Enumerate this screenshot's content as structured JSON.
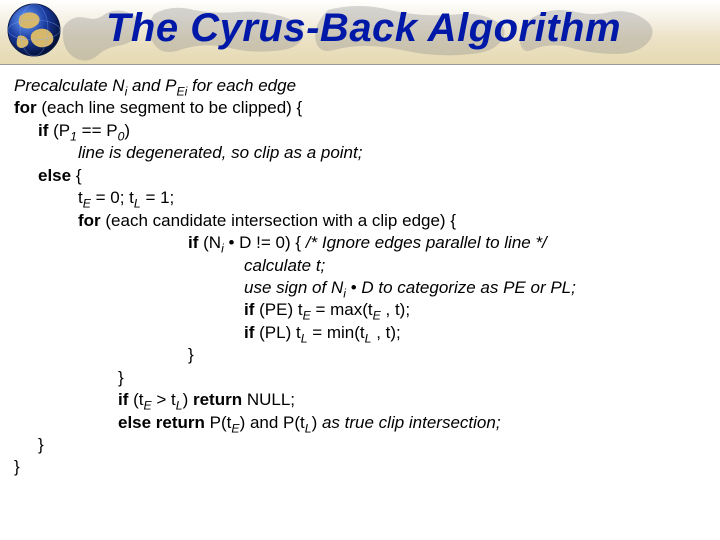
{
  "title": "The Cyrus-Back Algorithm",
  "globe_name": "globe-icon",
  "map_name": "world-map-icon",
  "lines": {
    "l0_a": "Precalculate N",
    "l0_b": " and P",
    "l0_c": " for each edge",
    "l1_a": "for",
    "l1_b": " (each line segment to be clipped) {",
    "l2_a": "if",
    "l2_b": " (P",
    "l2_c": " == P",
    "l2_d": ")",
    "l3": "line is degenerated, so clip as a point;",
    "l4_a": "else",
    "l4_b": " {",
    "l5_a": "t",
    "l5_b": " = 0;  t",
    "l5_c": " = 1;",
    "l6_a": "for",
    "l6_b": " (each candidate intersection with a clip edge) {",
    "l7_a": "if",
    "l7_b": " (N",
    "l7_c": " • D != 0) {   ",
    "l7_d": "/* Ignore edges parallel to line */",
    "l8": "calculate t;",
    "l9_a": "use sign of  N",
    "l9_b": " • D to categorize as PE or PL;",
    "l10_a": "if",
    "l10_b": " (PE) t",
    "l10_c": " = max(t",
    "l10_d": " ,  t);",
    "l11_a": "if",
    "l11_b": " (PL) t",
    "l11_c": " = min(t",
    "l11_d": " ,  t);",
    "l12": "}",
    "l13": "}",
    "l14_a": "if",
    "l14_b": " (t",
    "l14_c": " > t",
    "l14_d": ") ",
    "l14_e": "return",
    "l14_f": " NULL;",
    "l15_a": "else return",
    "l15_b": " P(t",
    "l15_c": ") and P(t",
    "l15_d": ") ",
    "l15_e": "as true clip intersection;",
    "l16": "}",
    "l17": "}",
    "sub_i": "i",
    "sub_Ei": "Ei",
    "sub_1": "1",
    "sub_0": "0",
    "sub_E": "E",
    "sub_L": "L"
  }
}
